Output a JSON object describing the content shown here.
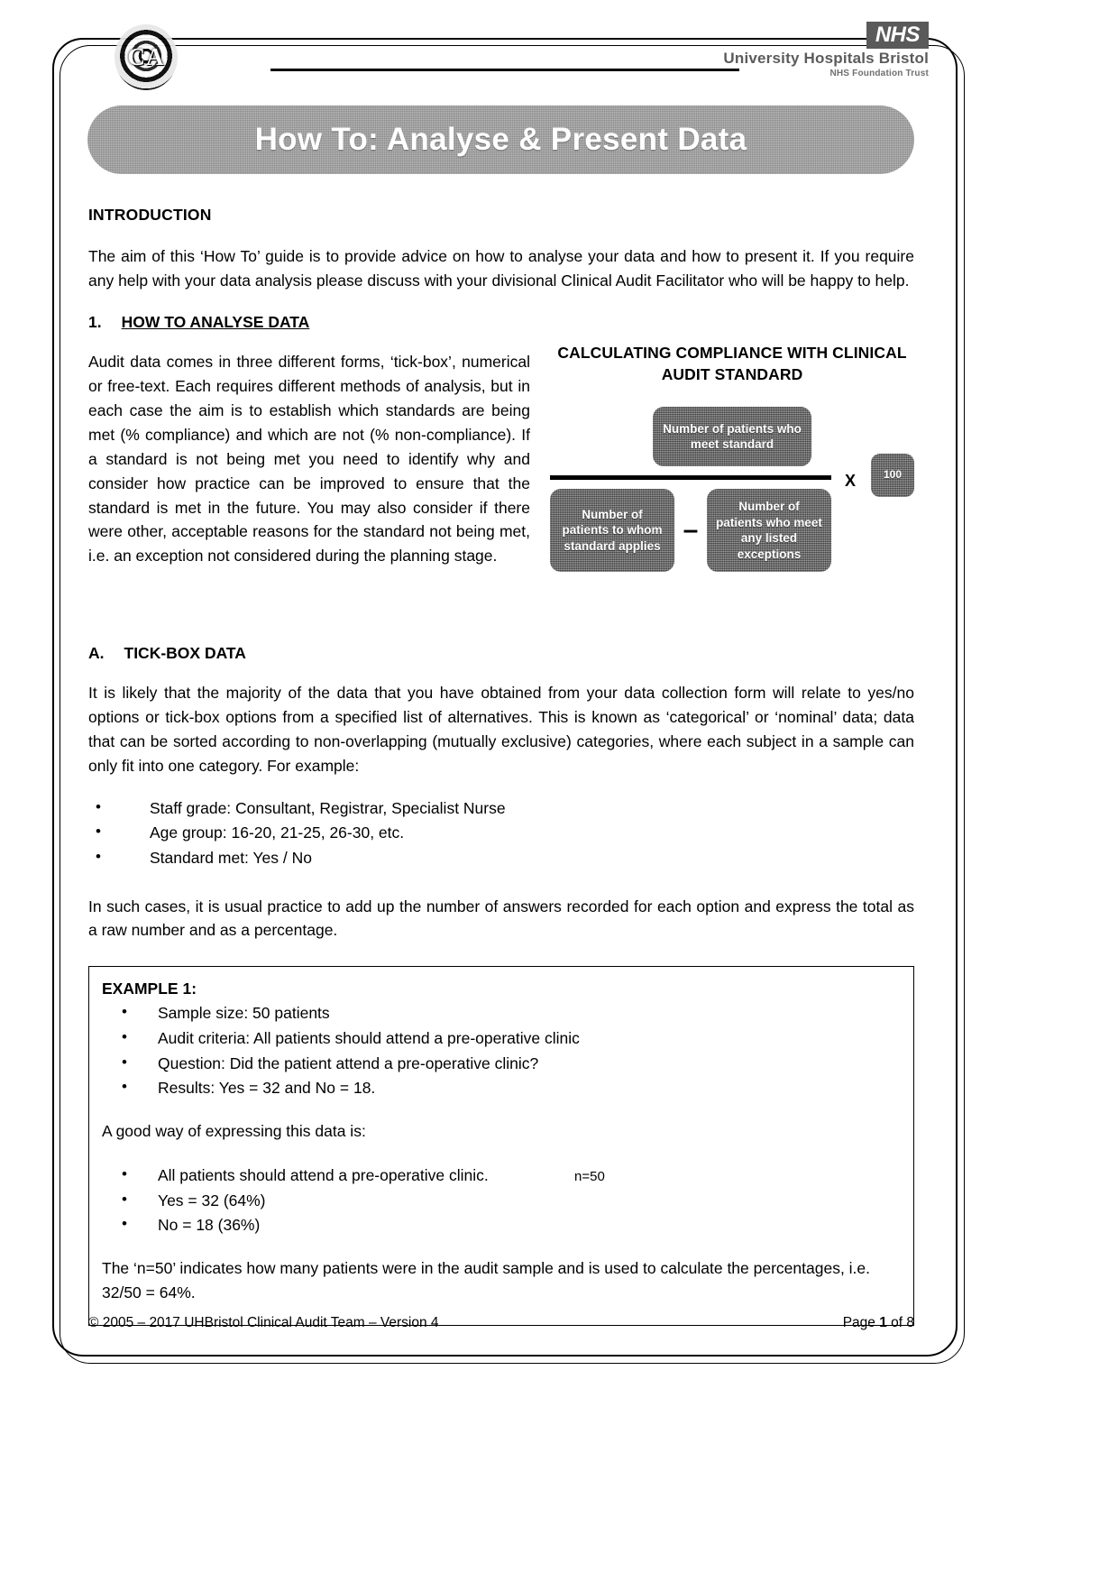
{
  "header": {
    "ca_logo_text": "CA",
    "nhs_badge": "NHS",
    "trust_name": "University Hospitals Bristol",
    "trust_sub": "NHS Foundation Trust"
  },
  "title": "How To: Analyse & Present Data",
  "intro": {
    "heading": "INTRODUCTION",
    "paragraph": "The aim of this ‘How To’ guide is to provide advice on how to analyse your data and how to present it. If you require any help with your data analysis please discuss with your divisional Clinical Audit Facilitator who will be happy to help."
  },
  "section1": {
    "number": "1.",
    "heading": "HOW TO ANALYSE DATA",
    "paragraph": "Audit data comes in three different forms, ‘tick-box’, numerical or free-text. Each requires different methods of analysis, but in each case the aim is to establish which standards are being met (% compliance) and which are not (% non-compliance). If a standard is not being met you need to identify why and consider how practice can be improved to ensure that the standard is met in the future. You may also consider if there were other, acceptable reasons for the standard not being met, i.e. an exception not considered during the planning stage."
  },
  "diagram": {
    "title": "CALCULATING COMPLIANCE WITH CLINICAL AUDIT STANDARD",
    "numerator": "Number of patients who meet standard",
    "denominator_left": "Number of patients to whom standard applies",
    "minus": "–",
    "denominator_right": "Number of patients who meet any listed exceptions",
    "times": "X",
    "multiplier": "100"
  },
  "sectionA": {
    "letter": "A.",
    "heading": "TICK-BOX DATA",
    "paragraph": "It is likely that the majority of the data that you have obtained from your data collection form will relate to yes/no options or tick-box options from a specified list of alternatives. This is known as ‘categorical’ or ‘nominal’ data; data that can be sorted according to non-overlapping (mutually exclusive) categories, where each subject in a sample can only fit into one category. For example:",
    "bullets": [
      "Staff grade: Consultant, Registrar, Specialist Nurse",
      "Age group: 16-20, 21-25, 26-30, etc.",
      "Standard met: Yes / No"
    ],
    "closing": "In such cases, it is usual practice to add up the number of answers recorded for each option and express the total as a raw number and as a percentage."
  },
  "example": {
    "title": "EXAMPLE 1:",
    "bullets": [
      "Sample size: 50 patients",
      "Audit criteria: All patients should attend a pre-operative clinic",
      "Question: Did the patient attend a pre-operative clinic?",
      "Results: Yes = 32 and No = 18."
    ],
    "lead_in": "A good way of expressing this data is:",
    "results": [
      {
        "label": "All patients should attend a pre-operative clinic.",
        "value": "n=50"
      },
      {
        "label": "Yes = 32 (64%)",
        "value": ""
      },
      {
        "label": "No = 18 (36%)",
        "value": ""
      }
    ],
    "note": "The ‘n=50’ indicates how many patients were in the audit sample and is used to calculate the percentages, i.e. 32/50 = 64%."
  },
  "footer": {
    "copyright": "© 2005 – 2017 UHBristol Clinical Audit Team – Version 4",
    "page_prefix": "Page ",
    "page_number": "1",
    "page_suffix": " of 8"
  }
}
